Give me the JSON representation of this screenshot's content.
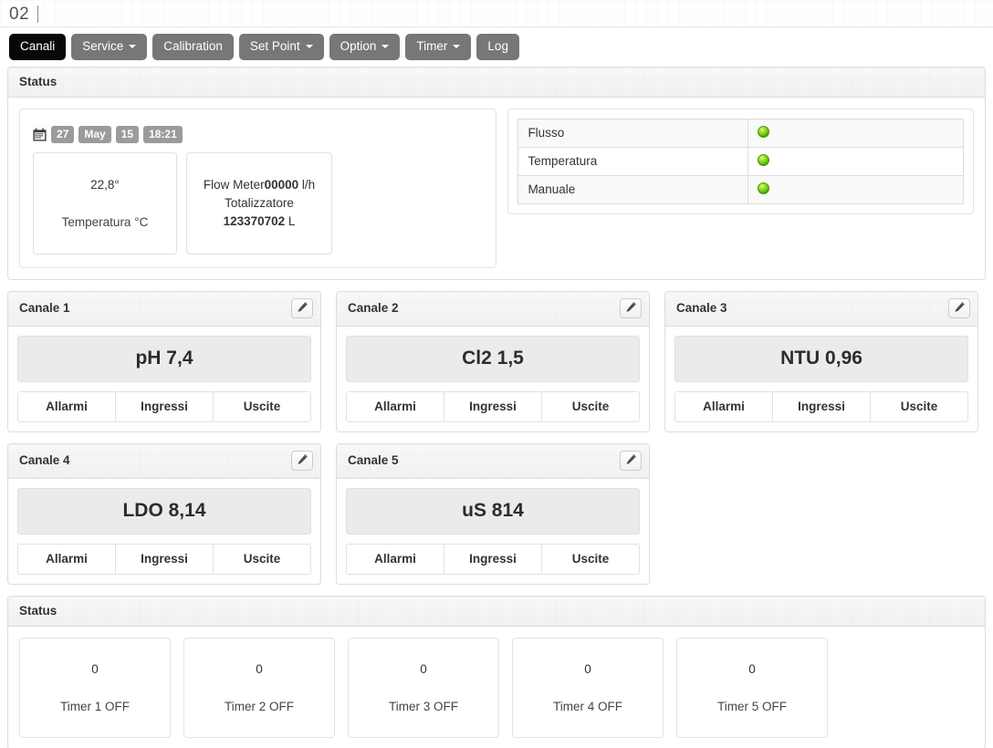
{
  "window": {
    "title": "02",
    "cursor_caret": "|"
  },
  "nav": {
    "items": [
      {
        "label": "Canali",
        "active": true,
        "dropdown": false
      },
      {
        "label": "Service",
        "active": false,
        "dropdown": true
      },
      {
        "label": "Calibration",
        "active": false,
        "dropdown": false
      },
      {
        "label": "Set Point",
        "active": false,
        "dropdown": true
      },
      {
        "label": "Option",
        "active": false,
        "dropdown": true
      },
      {
        "label": "Timer",
        "active": false,
        "dropdown": true
      },
      {
        "label": "Log",
        "active": false,
        "dropdown": false
      }
    ]
  },
  "status_panel": {
    "title": "Status",
    "datetime": {
      "icon": "calendar-icon",
      "day": "27",
      "month": "May",
      "year": "15",
      "time": "18:21"
    },
    "temperature": {
      "value": "22,8°",
      "label": "Temperatura °C"
    },
    "flow": {
      "flow_label": "Flow Meter",
      "flow_value": "00000",
      "flow_unit": "l/h",
      "total_label": "Totalizzatore",
      "total_value": "123370702",
      "total_unit": "L"
    },
    "indicators": [
      {
        "name": "Flusso",
        "state": "on",
        "color": "#7ed321"
      },
      {
        "name": "Temperatura",
        "state": "on",
        "color": "#7ed321"
      },
      {
        "name": "Manuale",
        "state": "on",
        "color": "#7ed321"
      }
    ]
  },
  "channels": [
    {
      "title": "Canale 1",
      "value": "pH 7,4",
      "edit_icon": "pencil-icon",
      "actions": [
        "Allarmi",
        "Ingressi",
        "Uscite"
      ]
    },
    {
      "title": "Canale 2",
      "value": "Cl2 1,5",
      "edit_icon": "pencil-icon",
      "actions": [
        "Allarmi",
        "Ingressi",
        "Uscite"
      ]
    },
    {
      "title": "Canale 3",
      "value": "NTU 0,96",
      "edit_icon": "pencil-icon",
      "actions": [
        "Allarmi",
        "Ingressi",
        "Uscite"
      ]
    },
    {
      "title": "Canale 4",
      "value": "LDO 8,14",
      "edit_icon": "pencil-icon",
      "actions": [
        "Allarmi",
        "Ingressi",
        "Uscite"
      ]
    },
    {
      "title": "Canale 5",
      "value": "uS 814",
      "edit_icon": "pencil-icon",
      "actions": [
        "Allarmi",
        "Ingressi",
        "Uscite"
      ]
    }
  ],
  "timer_panel": {
    "title": "Status",
    "timers": [
      {
        "count": "0",
        "label": "Timer 1 OFF"
      },
      {
        "count": "0",
        "label": "Timer 2 OFF"
      },
      {
        "count": "0",
        "label": "Timer 3 OFF"
      },
      {
        "count": "0",
        "label": "Timer 4 OFF"
      },
      {
        "count": "0",
        "label": "Timer 5 OFF"
      }
    ]
  }
}
